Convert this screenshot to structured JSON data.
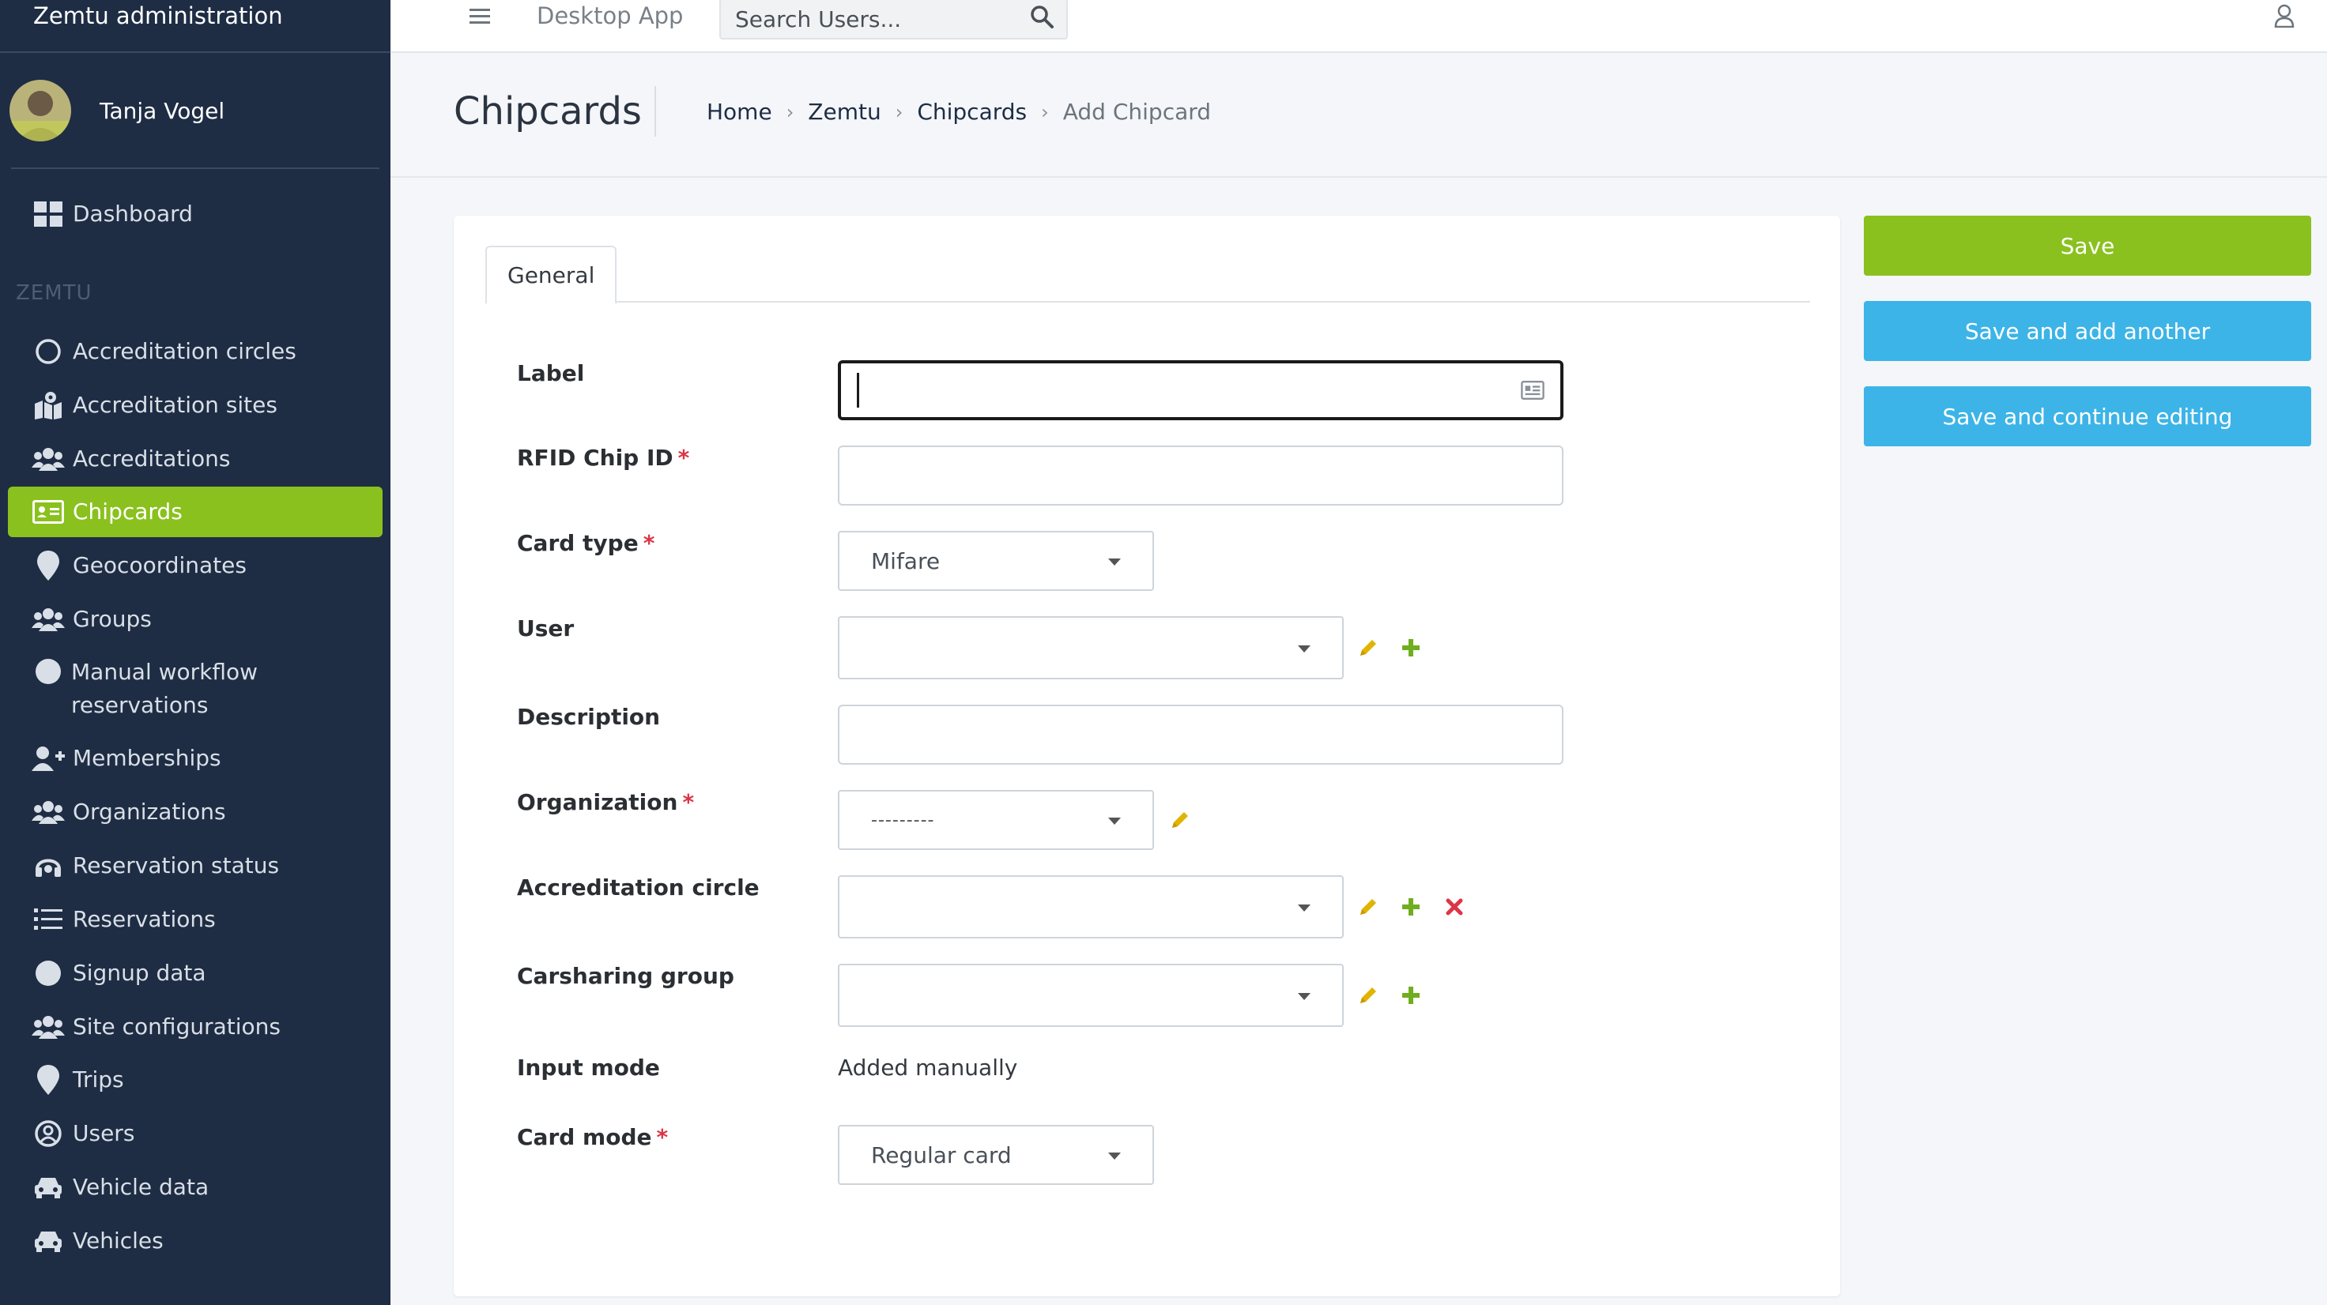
{
  "app": {
    "title": "Zemtu administration"
  },
  "user": {
    "name": "Tanja Vogel"
  },
  "sidebar": {
    "dashboard": "Dashboard",
    "section_header": "ZEMTU",
    "items": [
      {
        "label": "Accreditation circles",
        "icon": "circle-icon"
      },
      {
        "label": "Accreditation sites",
        "icon": "map-marked-icon"
      },
      {
        "label": "Accreditations",
        "icon": "users-icon"
      },
      {
        "label": "Chipcards",
        "icon": "id-card-icon",
        "active": true
      },
      {
        "label": "Geocoordinates",
        "icon": "map-marker-icon"
      },
      {
        "label": "Groups",
        "icon": "users-icon"
      },
      {
        "label": "Manual workflow",
        "label2": "reservations",
        "icon": "circle-filled-icon"
      },
      {
        "label": "Memberships",
        "icon": "user-plus-icon"
      },
      {
        "label": "Organizations",
        "icon": "users-icon"
      },
      {
        "label": "Reservation status",
        "icon": "headset-icon"
      },
      {
        "label": "Reservations",
        "icon": "list-icon"
      },
      {
        "label": "Signup data",
        "icon": "circle-filled-icon"
      },
      {
        "label": "Site configurations",
        "icon": "users-icon"
      },
      {
        "label": "Trips",
        "icon": "map-marker-icon"
      },
      {
        "label": "Users",
        "icon": "user-circle-icon"
      },
      {
        "label": "Vehicle data",
        "icon": "car-icon"
      },
      {
        "label": "Vehicles",
        "icon": "car-icon"
      }
    ]
  },
  "topbar": {
    "desktop_app": "Desktop App",
    "search_placeholder": "Search Users..."
  },
  "header": {
    "title": "Chipcards",
    "breadcrumb": [
      "Home",
      "Zemtu",
      "Chipcards"
    ],
    "current": "Add Chipcard"
  },
  "form": {
    "tab": "General",
    "label": {
      "label": "Label",
      "value": ""
    },
    "rfid": {
      "label": "RFID Chip ID",
      "required": "*",
      "value": ""
    },
    "card_type": {
      "label": "Card type",
      "required": "*",
      "value": "Mifare"
    },
    "user": {
      "label": "User",
      "value": ""
    },
    "description": {
      "label": "Description",
      "value": ""
    },
    "organization": {
      "label": "Organization",
      "required": "*",
      "value": "---------"
    },
    "accreditation_circle": {
      "label": "Accreditation circle",
      "value": ""
    },
    "carsharing_group": {
      "label": "Carsharing group",
      "value": ""
    },
    "input_mode": {
      "label": "Input mode",
      "value": "Added manually"
    },
    "card_mode": {
      "label": "Card mode",
      "required": "*",
      "value": "Regular card"
    }
  },
  "actions": {
    "save": "Save",
    "save_add": "Save and add another",
    "save_continue": "Save and continue editing"
  },
  "colors": {
    "sidebar_bg": "#1e2d44",
    "accent_green": "#8ac11e",
    "info_blue": "#3cb4e7",
    "required_red": "#dc3545",
    "edit_yellow": "#e0b400"
  }
}
